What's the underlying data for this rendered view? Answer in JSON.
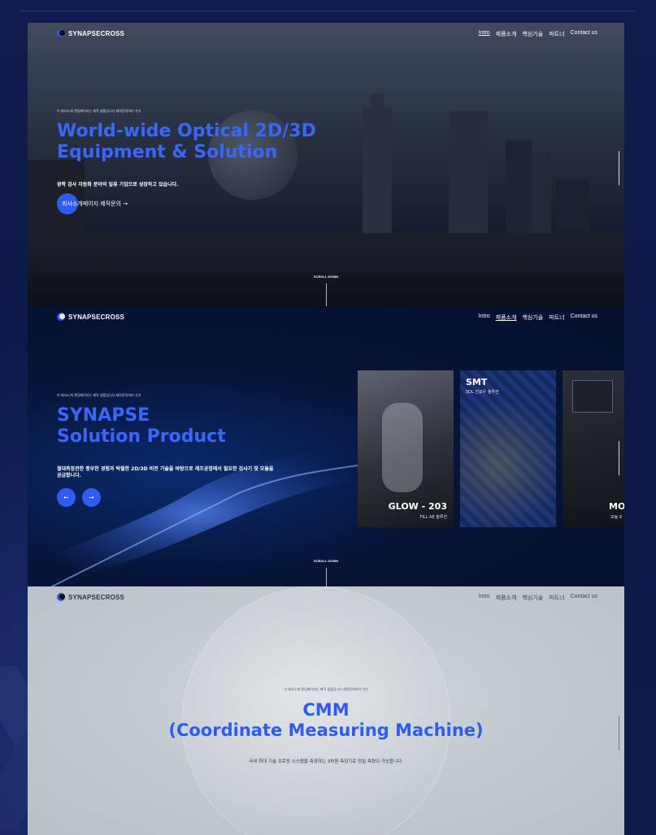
{
  "brand": {
    "name": "SYNAPSECROSS",
    "part1": "SYNAPSE",
    "part2": "CROSS"
  },
  "nav": [
    "Intro",
    "제품소개",
    "핵심기술",
    "파트너",
    "Contact us"
  ],
  "section1": {
    "note": "이 회사소개 랜딩페이지는 제작 샘플입니다.제작문의하러 가기",
    "title_line1": "World-wide Optical 2D/3D",
    "title_line2": "Equipment & Solution",
    "description": "광학 검사 자동화 분야의 일류 기업으로 성장하고 있습니다.",
    "cta": "회사소개페이지 제작문의 →",
    "scroll": "SCROLL DOWN",
    "active_nav": "Intro"
  },
  "section2": {
    "note": "이 회사소개 랜딩페이지는 제작 샘플입니다.제작문의하러 가기",
    "title_line1": "SYNAPSE",
    "title_line2": "Solution Product",
    "description_line1": "절대측정관한 풍부한 경험과 탁월한 2D/3D 비전 기술을 바탕으로 제조공정에서 필요한 검사기 및 모듈을",
    "description_line2": "공급합니다.",
    "prev": "←",
    "next": "→",
    "scroll": "SCROLL DOWN",
    "active_nav": "제품소개",
    "cards": [
      {
        "title": "GLOW - 203",
        "subtitle": "FILL AE 솔루션"
      },
      {
        "title": "SMT",
        "subtitle": "SOL 인모우 솔루션"
      },
      {
        "title": "MO",
        "subtitle": "모듈 9"
      }
    ]
  },
  "section3": {
    "note": "이 회사소개 랜딩페이지는 제작 샘플입니다.제작문의하러 가기",
    "title_line1": "CMM",
    "title_line2": "(Coordinate Measuring Machine)",
    "description": "국내 최대 기술 프로빙 시스템을 측정하는 3차원 측정기로 정밀 측정이 가능합니다."
  },
  "colors": {
    "accent": "#2f5bf0",
    "title_blue": "#3a66ff",
    "bg": "#0d1a45"
  }
}
